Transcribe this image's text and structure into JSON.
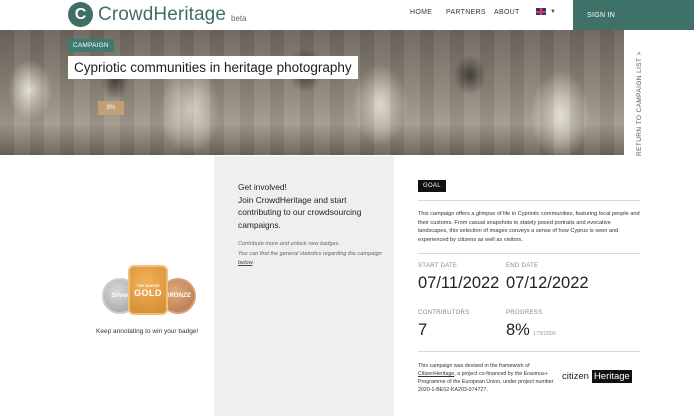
{
  "header": {
    "logo_letter": "C",
    "logo_text": "CrowdHeritage",
    "beta": "beta",
    "nav": [
      "HOME",
      "PARTNERS",
      "ABOUT"
    ],
    "lang_icon": "uk-flag-icon",
    "signin": "SIGN IN"
  },
  "hero": {
    "tag": "CAMPAIGN",
    "title": "Cypriotic communities in heritage photography",
    "progress_badge": "8%",
    "return_link": "RETURN TO CAMPAIGN LIST >"
  },
  "badges": {
    "silver": "Silver",
    "gold_top": "THE BADGE",
    "gold": "GOLD",
    "bronze": "BRONZE",
    "caption": "Keep annotating to win your badge!"
  },
  "involved": {
    "heading": "Get involved!\nJoin CrowdHeritage and start contributing to our crowdsourcing campaigns.",
    "note_1": "Contribute more and unlock new badges.",
    "note_2": "You can find the general statistics regarding the campaign ",
    "note_link": "below",
    "note_end": "."
  },
  "goal": {
    "tag": "GOAL",
    "description": "This campaign offers a glimpse of life in Cypriotic communities, featuring local people and their customs. From casual snapshots to stately posed portraits and evocative landscapes, this selection of images conveys a sense of how Cyprus is seen and experienced by citizens as well as visitors."
  },
  "stats": {
    "start_label": "START DATE",
    "start_value": "07/11/2022",
    "end_label": "END DATE",
    "end_value": "07/12/2022",
    "contributors_label": "CONTRIBUTORS",
    "contributors_value": "7",
    "progress_label": "PROGRESS",
    "progress_value": "8%",
    "progress_sub": "179/2000"
  },
  "footer": {
    "prefix": "This campaign was devised in the framework of ",
    "project": "CitizenHeritage",
    "rest": ", a project co-financed by the Erasmus+ Programme of the European Union, under project number 2020-1-BE02-KA203-074727.",
    "logo_plain": "citizen",
    "logo_boxed": "Heritage"
  },
  "colors": {
    "brand": "#3f6e68",
    "signin_bg": "#3e7168",
    "goal_tag": "#111111"
  }
}
